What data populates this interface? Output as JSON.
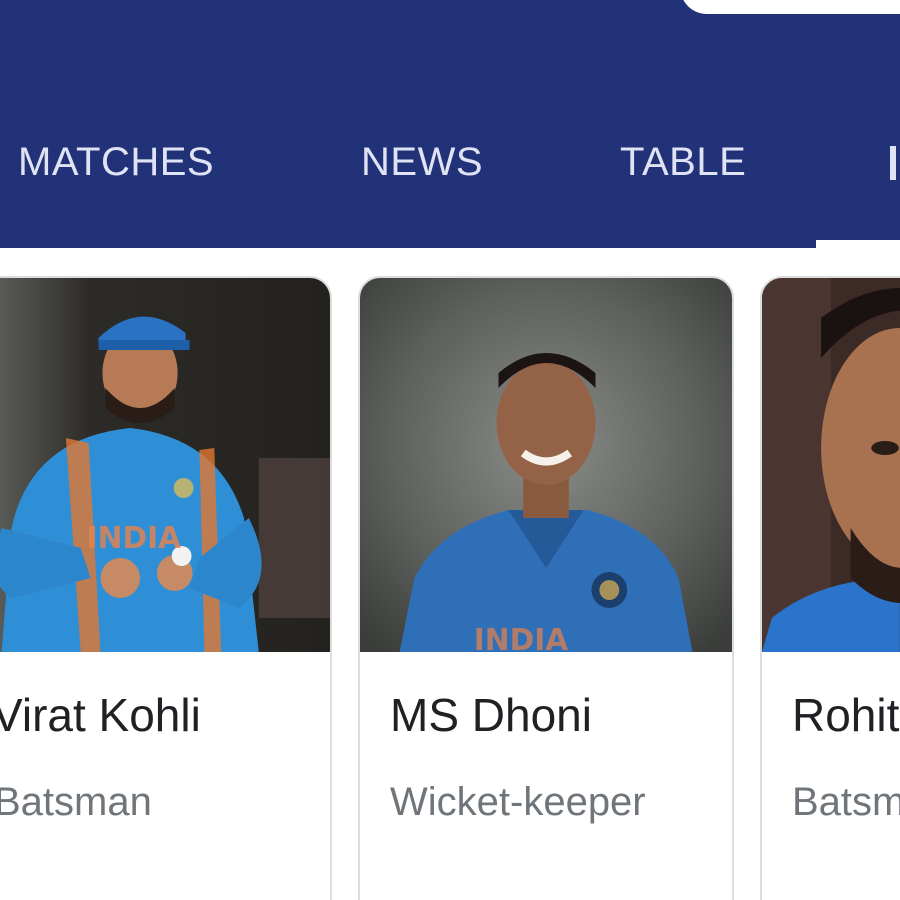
{
  "tabs": [
    {
      "label": "MATCHES"
    },
    {
      "label": "NEWS"
    },
    {
      "label": "TABLE"
    }
  ],
  "colors": {
    "header_bg": "#223278",
    "tab_text": "#dfe3f3",
    "name_text": "#202124",
    "role_text": "#70757a"
  },
  "players": [
    {
      "name": "Virat Kohli",
      "role": "Batsman"
    },
    {
      "name": "MS Dhoni",
      "role": "Wicket-keeper"
    },
    {
      "name": "Rohit",
      "role": "Batsm"
    }
  ]
}
